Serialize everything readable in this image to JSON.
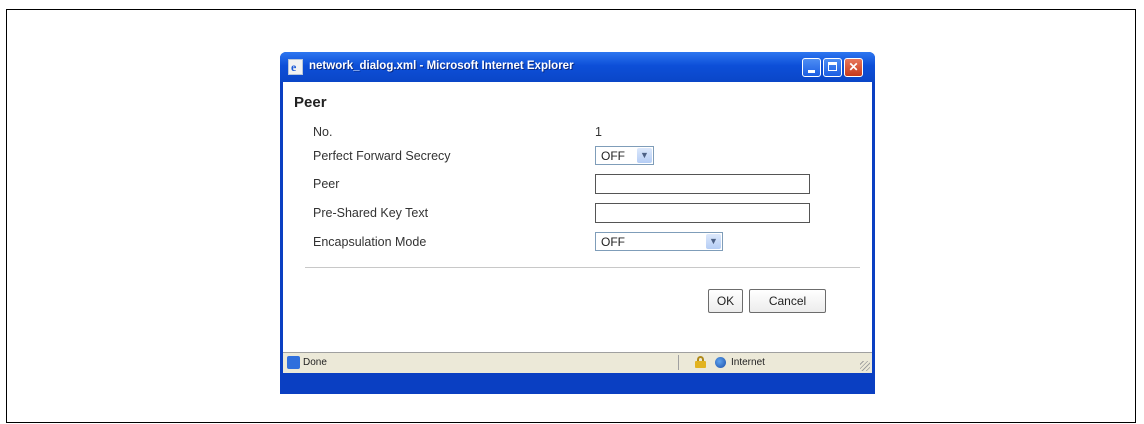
{
  "window": {
    "title": "network_dialog.xml - Microsoft Internet Explorer",
    "controls": {
      "minimize": "minimize",
      "maximize": "maximize",
      "close": "✕"
    }
  },
  "dialog": {
    "heading": "Peer",
    "fields": {
      "no": {
        "label": "No.",
        "value": "1"
      },
      "pfs": {
        "label": "Perfect Forward Secrecy",
        "value": "OFF"
      },
      "peer": {
        "label": "Peer",
        "value": ""
      },
      "psk": {
        "label": "Pre-Shared Key Text",
        "value": ""
      },
      "encap": {
        "label": "Encapsulation Mode",
        "value": "OFF"
      }
    },
    "buttons": {
      "ok": "OK",
      "cancel": "Cancel"
    }
  },
  "statusbar": {
    "status": "Done",
    "zone": "Internet"
  },
  "icons": {
    "app": "ie-page-icon",
    "dropdown": "chevron-down-icon",
    "lock": "lock-icon",
    "zone": "globe-icon"
  }
}
